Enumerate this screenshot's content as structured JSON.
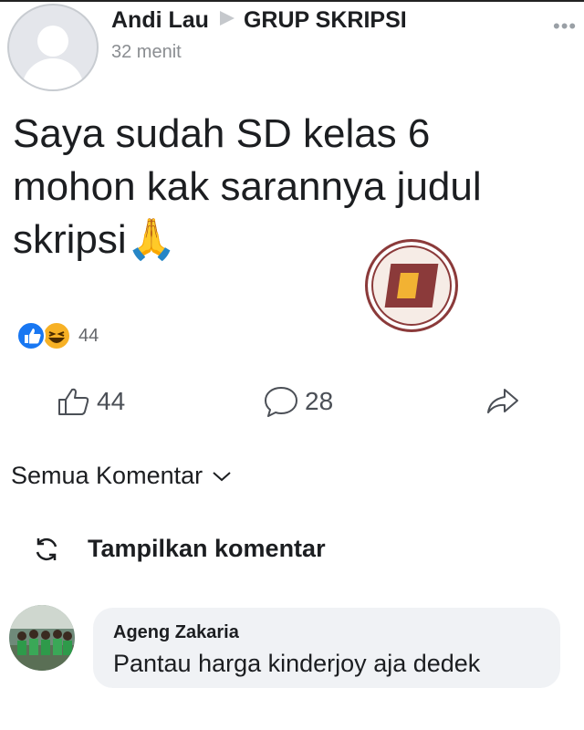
{
  "post": {
    "author": "Andi Lau",
    "group": "GRUP SKRIPSI",
    "time": "32 menit",
    "text": "Saya sudah SD kelas 6 mohon kak sarannya judul skripsi",
    "emoji": "🙏"
  },
  "reactions": {
    "summary_count": "44",
    "icons": [
      "like-icon",
      "haha-icon"
    ]
  },
  "actions": {
    "like_count": "44",
    "comment_count": "28"
  },
  "comments": {
    "filter_label": "Semua Komentar",
    "show_label": "Tampilkan komentar",
    "items": [
      {
        "name": "Ageng Zakaria",
        "text": "Pantau harga kinderjoy aja dedek"
      }
    ]
  },
  "colors": {
    "like_blue": "#1877f2",
    "haha_yellow": "#f7b125",
    "watermark_red": "#8b3a3a"
  }
}
